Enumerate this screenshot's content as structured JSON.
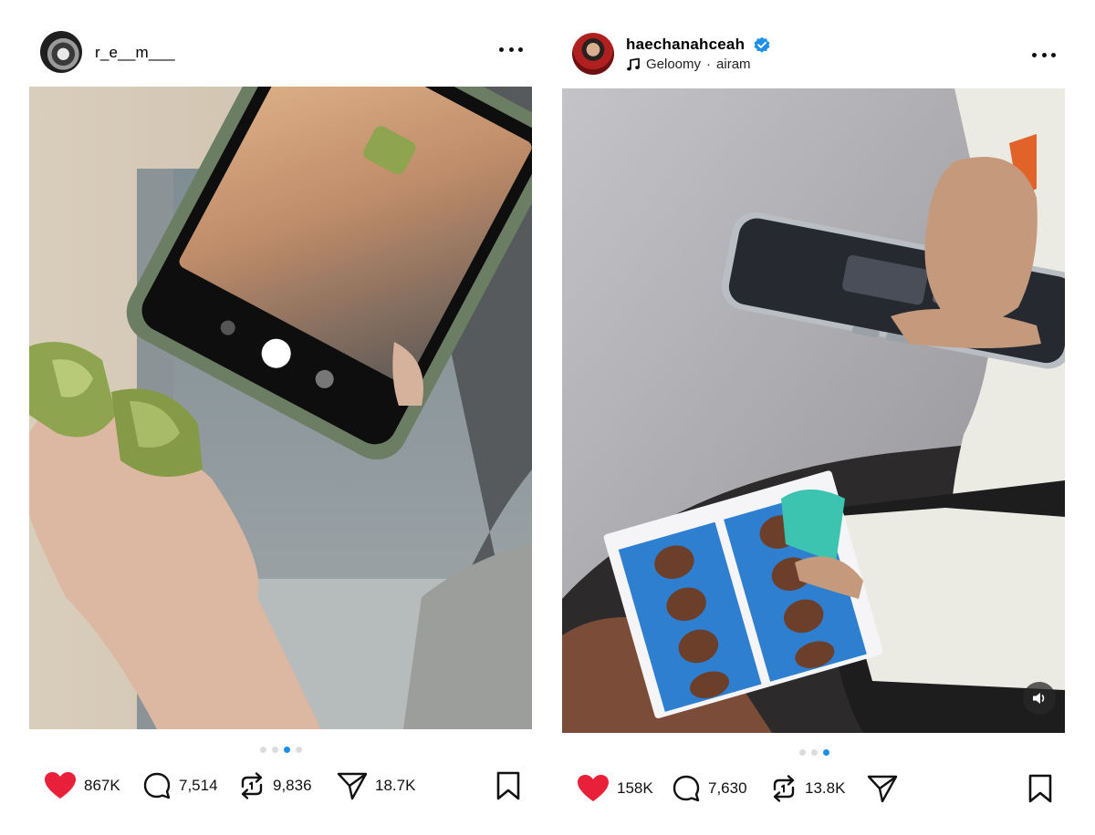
{
  "posts": [
    {
      "username": "r_e__m___",
      "verified": false,
      "music": null,
      "carousel": {
        "count": 4,
        "active": 3
      },
      "stats": {
        "likes": "867K",
        "comments": "7,514",
        "reposts": "9,836",
        "shares": "18.7K"
      },
      "liked": true,
      "colors": {
        "like": "#e8203a",
        "dot_active": "#1d8fe8"
      }
    },
    {
      "username": "haechanahceah",
      "verified": true,
      "music": {
        "song": "Geloomy",
        "separator": "·",
        "artist": "airam"
      },
      "carousel": {
        "count": 3,
        "active": 3
      },
      "stats": {
        "likes": "158K",
        "comments": "7,630",
        "reposts": "13.8K"
      },
      "liked": true,
      "has_volume_button": true,
      "colors": {
        "like": "#e8203a",
        "verified": "#1d8fe8",
        "dot_active": "#1d8fe8"
      }
    }
  ],
  "icons": {
    "more": "more-options-icon",
    "like": "heart-icon",
    "comment": "comment-bubble-icon",
    "repost": "repost-icon",
    "share": "paper-plane-icon",
    "save": "bookmark-icon",
    "music": "music-note-icon",
    "volume": "speaker-icon"
  }
}
